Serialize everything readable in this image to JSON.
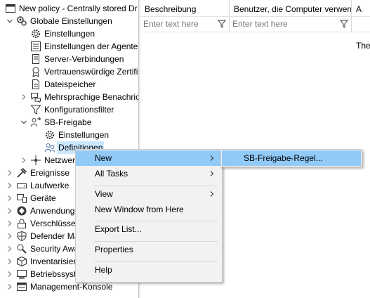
{
  "tree": {
    "items": [
      {
        "label": "New policy - Centrally stored Dr",
        "icon": "policy-window-icon",
        "expander": "none"
      },
      {
        "label": "Globale Einstellungen",
        "icon": "settings-gears-icon",
        "expander": "open"
      },
      {
        "label": "Einstellungen",
        "icon": "gear-icon",
        "expander": "none"
      },
      {
        "label": "Einstellungen der Agenten",
        "icon": "agent-settings-icon",
        "expander": "none"
      },
      {
        "label": "Server-Verbindungen",
        "icon": "server-icon",
        "expander": "none"
      },
      {
        "label": "Vertrauenswürdige Zertifikate",
        "icon": "certificate-icon",
        "expander": "none"
      },
      {
        "label": "Dateispeicher",
        "icon": "file-storage-icon",
        "expander": "none"
      },
      {
        "label": "Mehrsprachige Benachrichtigungen",
        "icon": "chat-bubbles-icon",
        "expander": "closed"
      },
      {
        "label": "Konfigurationsfilter",
        "icon": "filter-icon",
        "expander": "none"
      },
      {
        "label": "SB-Freigabe",
        "icon": "sharing-icon",
        "expander": "open"
      },
      {
        "label": "Einstellungen",
        "icon": "gear-icon",
        "expander": "none"
      },
      {
        "label": "Definitionen",
        "icon": "definitions-icon",
        "expander": "none",
        "selected": true
      },
      {
        "label": "Netzwerk",
        "icon": "network-icon",
        "expander": "closed"
      },
      {
        "label": "Ereignisse",
        "icon": "events-icon",
        "expander": "closed"
      },
      {
        "label": "Laufwerke",
        "icon": "drive-icon",
        "expander": "closed"
      },
      {
        "label": "Geräte",
        "icon": "devices-icon",
        "expander": "closed"
      },
      {
        "label": "Anwendungen",
        "icon": "applications-icon",
        "expander": "closed"
      },
      {
        "label": "Verschlüsselung",
        "icon": "encryption-icon",
        "expander": "closed"
      },
      {
        "label": "Defender Management",
        "icon": "shield-icon",
        "expander": "closed"
      },
      {
        "label": "Security Awareness",
        "icon": "awareness-icon",
        "expander": "closed"
      },
      {
        "label": "Inventarisierung",
        "icon": "inventory-icon",
        "expander": "closed"
      },
      {
        "label": "Betriebssystem",
        "icon": "computer-icon",
        "expander": "closed"
      },
      {
        "label": "Management-Konsole",
        "icon": "console-icon",
        "expander": "closed"
      }
    ]
  },
  "grid": {
    "columns": [
      {
        "label": "Beschreibung",
        "filter_placeholder": "Enter text here"
      },
      {
        "label": "Benutzer, die Computer verwenden",
        "filter_placeholder": "Enter text here"
      },
      {
        "label": "A",
        "filter_placeholder": ""
      }
    ],
    "empty_text": "The"
  },
  "context_menu": {
    "items": [
      {
        "label": "New",
        "submenu": true,
        "highlighted": true
      },
      {
        "label": "All Tasks",
        "submenu": true
      },
      {
        "separator": true
      },
      {
        "label": "View",
        "submenu": true
      },
      {
        "label": "New Window from Here"
      },
      {
        "separator": true
      },
      {
        "label": "Export List..."
      },
      {
        "separator": true
      },
      {
        "label": "Properties"
      },
      {
        "separator": true
      },
      {
        "label": "Help"
      }
    ]
  },
  "submenu": {
    "items": [
      {
        "label": "SB-Freigabe-Regel..."
      }
    ]
  },
  "colors": {
    "highlight": "#91c9f7",
    "menu_bg": "#f2f2f2",
    "selected": "#cce8ff"
  }
}
